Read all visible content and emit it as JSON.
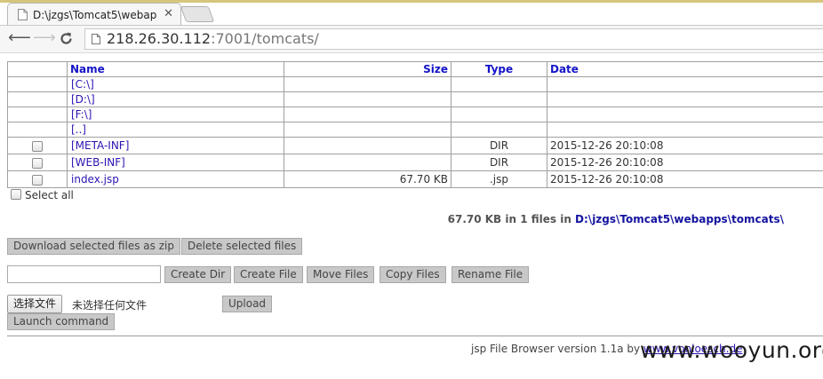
{
  "browser": {
    "tab_title": "D:\\jzgs\\Tomcat5\\webap",
    "url_host": "218.26.30.112",
    "url_rest": ":7001/tomcats/"
  },
  "table": {
    "headers": {
      "name": "Name",
      "size": "Size",
      "type": "Type",
      "date": "Date"
    },
    "drives": [
      "[C:\\]",
      "[D:\\]",
      "[F:\\]",
      "[..]"
    ],
    "files": [
      {
        "name": "[META-INF]",
        "size": "",
        "type": "DIR",
        "date": "2015-12-26 20:10:08"
      },
      {
        "name": "[WEB-INF]",
        "size": "",
        "type": "DIR",
        "date": "2015-12-26 20:10:08"
      },
      {
        "name": "index.jsp",
        "size": "67.70 KB",
        "type": ".jsp",
        "date": "2015-12-26 20:10:08"
      }
    ]
  },
  "select_all_label": "Select all",
  "summary": {
    "text": "67.70 KB in 1 files in ",
    "path": "D:\\jzgs\\Tomcat5\\webapps\\tomcats\\"
  },
  "actions": {
    "download_zip": "Download selected files as zip",
    "delete_files": "Delete selected files",
    "create_dir": "Create Dir",
    "create_file": "Create File",
    "move_files": "Move Files",
    "copy_files": "Copy Files",
    "rename_file": "Rename File",
    "choose_file": "选择文件",
    "no_file_chosen": "未选择任何文件",
    "upload": "Upload",
    "launch_command": "Launch command"
  },
  "footer": {
    "text": "jsp File Browser version 1.1a by ",
    "link": "www.vonloesch.de"
  },
  "watermark": "www.wooyun.org"
}
